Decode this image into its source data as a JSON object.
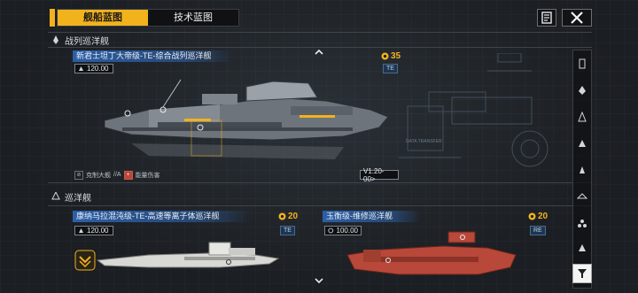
{
  "tabs": [
    {
      "label": "舰船蓝图",
      "active": true
    },
    {
      "label": "技术蓝图",
      "active": false
    }
  ],
  "sections": {
    "battlecruiser": {
      "label": "战列巡洋舰"
    },
    "cruiser": {
      "label": "巡洋舰"
    }
  },
  "ships": [
    {
      "name": "新君士坦丁大帝级-TE-综合战列巡洋舰",
      "stat": "120.00",
      "cost": "35",
      "type_badge": "TE",
      "version": "V1.20-00>",
      "tags": [
        {
          "label": "克制大舰",
          "symbol": "//A"
        },
        {
          "label": "能量伤害",
          "symbol": ""
        }
      ],
      "hull_color": "#8a9096"
    },
    {
      "name": "康纳马拉混沌级-TE-高速等离子体巡洋舰",
      "stat": "120.00",
      "cost": "20",
      "type_badge": "TE",
      "hull_color": "#d8d8d4"
    },
    {
      "name": "玉衡级-维修巡洋舰",
      "stat": "100.00",
      "cost": "20",
      "type_badge": "RE",
      "hull_color": "#b8483a"
    }
  ],
  "decor": {
    "data_transfer": "DATA TRANSFER"
  },
  "colors": {
    "accent": "#f2b21c",
    "title_bar": "#2c5fa8"
  },
  "icons": [
    "document-icon",
    "close-icon",
    "chevron-up-icon",
    "chevron-down-icon",
    "filter-icon"
  ]
}
